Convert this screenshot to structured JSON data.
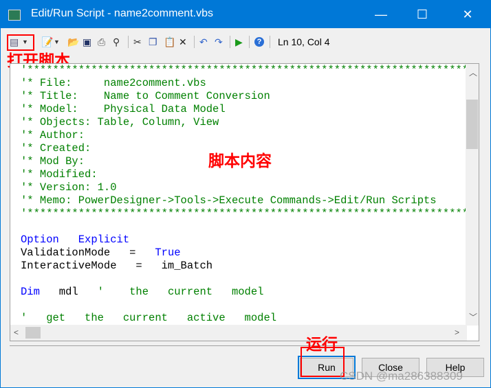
{
  "window": {
    "title": "Edit/Run Script - name2comment.vbs",
    "minimize": "—",
    "maximize": "☐",
    "close": "✕"
  },
  "toolbar": {
    "status": "Ln 10, Col 4",
    "icons": [
      "open-script-icon",
      "new-icon",
      "open-folder-icon",
      "save-icon",
      "print-icon",
      "find-icon",
      "cut-icon",
      "copy-icon",
      "paste-icon",
      "delete-icon",
      "undo-icon",
      "redo-icon",
      "run-icon",
      "help-icon"
    ]
  },
  "annotations": {
    "open_script": "打开脚本",
    "script_content": "脚本内容",
    "run": "运行"
  },
  "code": [
    {
      "t": "c",
      "s": "'*******************************************************************************"
    },
    {
      "t": "c",
      "s": "'* File:     name2comment.vbs"
    },
    {
      "t": "c",
      "s": "'* Title:    Name to Comment Conversion"
    },
    {
      "t": "c",
      "s": "'* Model:    Physical Data Model"
    },
    {
      "t": "c",
      "s": "'* Objects: Table, Column, View"
    },
    {
      "t": "c",
      "s": "'* Author:"
    },
    {
      "t": "c",
      "s": "'* Created:"
    },
    {
      "t": "c",
      "s": "'* Mod By:"
    },
    {
      "t": "c",
      "s": "'* Modified:"
    },
    {
      "t": "c",
      "s": "'* Version: 1.0"
    },
    {
      "t": "c",
      "s": "'* Memo: PowerDesigner->Tools->Execute Commands->Edit/Run Scripts"
    },
    {
      "t": "c",
      "s": "'*******************************************************************************"
    },
    {
      "t": "n",
      "s": ""
    },
    {
      "t": "k",
      "s": "Option   Explicit"
    },
    {
      "t": "m",
      "a": "ValidationMode   =   ",
      "b": "True"
    },
    {
      "t": "n",
      "s": "InteractiveMode   =   im_Batch"
    },
    {
      "t": "n",
      "s": ""
    },
    {
      "t": "m2",
      "a": "Dim",
      "b": "   mdl   ",
      "c": "'    the   current   model"
    },
    {
      "t": "n",
      "s": ""
    },
    {
      "t": "c",
      "s": "'   get   the   current   active   model"
    }
  ],
  "buttons": {
    "run": "Run",
    "close": "Close",
    "help": "Help"
  },
  "watermark": "CSDN @ma286388309",
  "colors": {
    "titlebar": "#0078d7",
    "comment": "#008000",
    "keyword": "#0000ff",
    "annotation": "#ff0000"
  }
}
